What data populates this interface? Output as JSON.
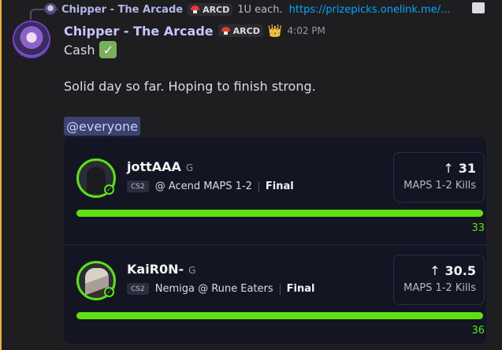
{
  "reply": {
    "author": "Chipper - The Arcade",
    "tag": "ARCD",
    "text": "1U each.",
    "link": "https://prizepicks.onelink.me/..."
  },
  "message": {
    "author": "Chipper - The Arcade",
    "tag": "ARCD",
    "crown": "👑",
    "time": "4:02 PM",
    "line1": "Cash",
    "check": "✓",
    "line2": "Solid day so far. Hoping to finish strong.",
    "mention": "@everyone"
  },
  "picks": [
    {
      "player": "jottAAA",
      "pos": "G",
      "game": "CS2",
      "matchup": "@ Acend MAPS 1-2",
      "status": "Final",
      "arrow": "↑",
      "line": "31",
      "stat": "MAPS 1-2 Kills",
      "result": "33",
      "progress": 1.0
    },
    {
      "player": "KaiR0N-",
      "pos": "G",
      "game": "CS2",
      "matchup": "Nemiga @ Rune Eaters",
      "status": "Final",
      "arrow": "↑",
      "line": "30.5",
      "stat": "MAPS 1-2 Kills",
      "result": "36",
      "progress": 1.0
    }
  ],
  "colors": {
    "accent": "#5ce210",
    "author": "#c3c6ff",
    "link": "#00a8fc",
    "mention_bg": "#3c4270"
  }
}
